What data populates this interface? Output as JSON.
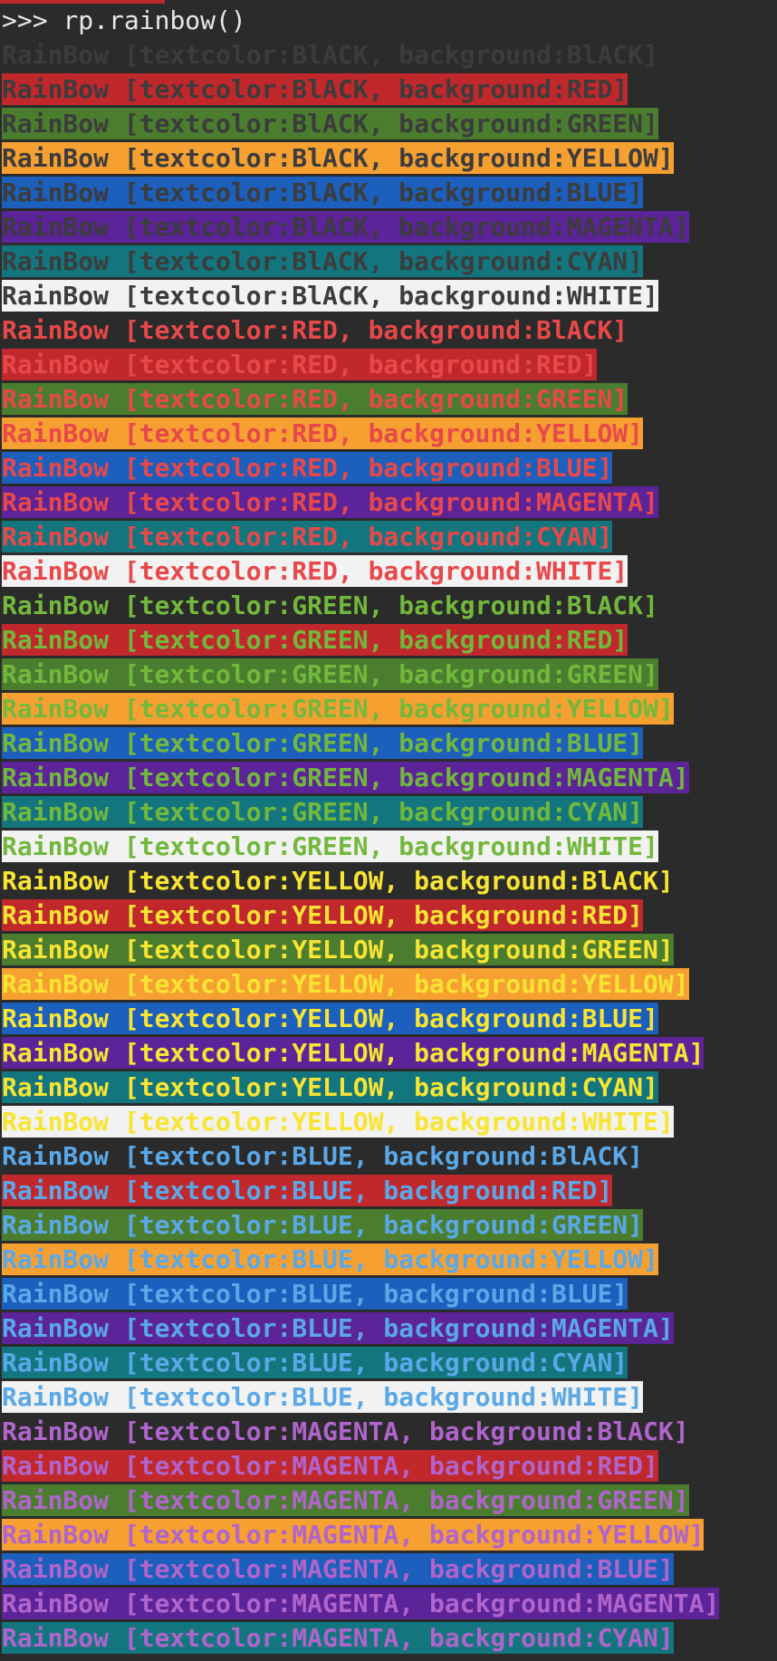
{
  "terminal": {
    "prompt": ">>> ",
    "command": "rp.rainbow()"
  },
  "colors": {
    "text": {
      "BlACK": "#3c3c3c",
      "RED": "#e8484a",
      "GREEN": "#72b83c",
      "YELLOW": "#f8e432",
      "BLUE": "#5aa8e8",
      "MAGENTA": "#b064cc"
    },
    "background": {
      "BlACK": "#2b2b2b",
      "RED": "#c0282c",
      "GREEN": "#4b7d2f",
      "YELLOW": "#f7a032",
      "BLUE": "#1c5fbc",
      "MAGENTA": "#5c2498",
      "CYAN": "#13767e",
      "WHITE": "#f2f2f2"
    }
  },
  "rows": [
    {
      "text": "RainBow [textcolor:BlACK, background:BlACK]",
      "fg": "BlACK",
      "bg": "BlACK"
    },
    {
      "text": "RainBow [textcolor:BlACK, background:RED]",
      "fg": "BlACK",
      "bg": "RED"
    },
    {
      "text": "RainBow [textcolor:BlACK, background:GREEN]",
      "fg": "BlACK",
      "bg": "GREEN"
    },
    {
      "text": "RainBow [textcolor:BlACK, background:YELLOW]",
      "fg": "BlACK",
      "bg": "YELLOW"
    },
    {
      "text": "RainBow [textcolor:BlACK, background:BLUE]",
      "fg": "BlACK",
      "bg": "BLUE"
    },
    {
      "text": "RainBow [textcolor:BlACK, background:MAGENTA]",
      "fg": "BlACK",
      "bg": "MAGENTA"
    },
    {
      "text": "RainBow [textcolor:BlACK, background:CYAN]",
      "fg": "BlACK",
      "bg": "CYAN"
    },
    {
      "text": "RainBow [textcolor:BlACK, background:WHITE]",
      "fg": "BlACK",
      "bg": "WHITE"
    },
    {
      "text": "RainBow [textcolor:RED, background:BlACK]",
      "fg": "RED",
      "bg": "BlACK"
    },
    {
      "text": "RainBow [textcolor:RED, background:RED]",
      "fg": "RED",
      "bg": "RED"
    },
    {
      "text": "RainBow [textcolor:RED, background:GREEN]",
      "fg": "RED",
      "bg": "GREEN"
    },
    {
      "text": "RainBow [textcolor:RED, background:YELLOW]",
      "fg": "RED",
      "bg": "YELLOW"
    },
    {
      "text": "RainBow [textcolor:RED, background:BLUE]",
      "fg": "RED",
      "bg": "BLUE"
    },
    {
      "text": "RainBow [textcolor:RED, background:MAGENTA]",
      "fg": "RED",
      "bg": "MAGENTA"
    },
    {
      "text": "RainBow [textcolor:RED, background:CYAN]",
      "fg": "RED",
      "bg": "CYAN"
    },
    {
      "text": "RainBow [textcolor:RED, background:WHITE]",
      "fg": "RED",
      "bg": "WHITE"
    },
    {
      "text": "RainBow [textcolor:GREEN, background:BlACK]",
      "fg": "GREEN",
      "bg": "BlACK"
    },
    {
      "text": "RainBow [textcolor:GREEN, background:RED]",
      "fg": "GREEN",
      "bg": "RED"
    },
    {
      "text": "RainBow [textcolor:GREEN, background:GREEN]",
      "fg": "GREEN",
      "bg": "GREEN"
    },
    {
      "text": "RainBow [textcolor:GREEN, background:YELLOW]",
      "fg": "GREEN",
      "bg": "YELLOW"
    },
    {
      "text": "RainBow [textcolor:GREEN, background:BLUE]",
      "fg": "GREEN",
      "bg": "BLUE"
    },
    {
      "text": "RainBow [textcolor:GREEN, background:MAGENTA]",
      "fg": "GREEN",
      "bg": "MAGENTA"
    },
    {
      "text": "RainBow [textcolor:GREEN, background:CYAN]",
      "fg": "GREEN",
      "bg": "CYAN"
    },
    {
      "text": "RainBow [textcolor:GREEN, background:WHITE]",
      "fg": "GREEN",
      "bg": "WHITE"
    },
    {
      "text": "RainBow [textcolor:YELLOW, background:BlACK]",
      "fg": "YELLOW",
      "bg": "BlACK"
    },
    {
      "text": "RainBow [textcolor:YELLOW, background:RED]",
      "fg": "YELLOW",
      "bg": "RED"
    },
    {
      "text": "RainBow [textcolor:YELLOW, background:GREEN]",
      "fg": "YELLOW",
      "bg": "GREEN"
    },
    {
      "text": "RainBow [textcolor:YELLOW, background:YELLOW]",
      "fg": "YELLOW",
      "bg": "YELLOW"
    },
    {
      "text": "RainBow [textcolor:YELLOW, background:BLUE]",
      "fg": "YELLOW",
      "bg": "BLUE"
    },
    {
      "text": "RainBow [textcolor:YELLOW, background:MAGENTA]",
      "fg": "YELLOW",
      "bg": "MAGENTA"
    },
    {
      "text": "RainBow [textcolor:YELLOW, background:CYAN]",
      "fg": "YELLOW",
      "bg": "CYAN"
    },
    {
      "text": "RainBow [textcolor:YELLOW, background:WHITE]",
      "fg": "YELLOW",
      "bg": "WHITE"
    },
    {
      "text": "RainBow [textcolor:BLUE, background:BlACK]",
      "fg": "BLUE",
      "bg": "BlACK"
    },
    {
      "text": "RainBow [textcolor:BLUE, background:RED]",
      "fg": "BLUE",
      "bg": "RED"
    },
    {
      "text": "RainBow [textcolor:BLUE, background:GREEN]",
      "fg": "BLUE",
      "bg": "GREEN"
    },
    {
      "text": "RainBow [textcolor:BLUE, background:YELLOW]",
      "fg": "BLUE",
      "bg": "YELLOW"
    },
    {
      "text": "RainBow [textcolor:BLUE, background:BLUE]",
      "fg": "BLUE",
      "bg": "BLUE"
    },
    {
      "text": "RainBow [textcolor:BLUE, background:MAGENTA]",
      "fg": "BLUE",
      "bg": "MAGENTA"
    },
    {
      "text": "RainBow [textcolor:BLUE, background:CYAN]",
      "fg": "BLUE",
      "bg": "CYAN"
    },
    {
      "text": "RainBow [textcolor:BLUE, background:WHITE]",
      "fg": "BLUE",
      "bg": "WHITE"
    },
    {
      "text": "RainBow [textcolor:MAGENTA, background:BlACK]",
      "fg": "MAGENTA",
      "bg": "BlACK"
    },
    {
      "text": "RainBow [textcolor:MAGENTA, background:RED]",
      "fg": "MAGENTA",
      "bg": "RED"
    },
    {
      "text": "RainBow [textcolor:MAGENTA, background:GREEN]",
      "fg": "MAGENTA",
      "bg": "GREEN"
    },
    {
      "text": "RainBow [textcolor:MAGENTA, background:YELLOW]",
      "fg": "MAGENTA",
      "bg": "YELLOW"
    },
    {
      "text": "RainBow [textcolor:MAGENTA, background:BLUE]",
      "fg": "MAGENTA",
      "bg": "BLUE"
    },
    {
      "text": "RainBow [textcolor:MAGENTA, background:MAGENTA]",
      "fg": "MAGENTA",
      "bg": "MAGENTA"
    },
    {
      "text": "RainBow [textcolor:MAGENTA, background:CYAN]",
      "fg": "MAGENTA",
      "bg": "CYAN"
    }
  ]
}
